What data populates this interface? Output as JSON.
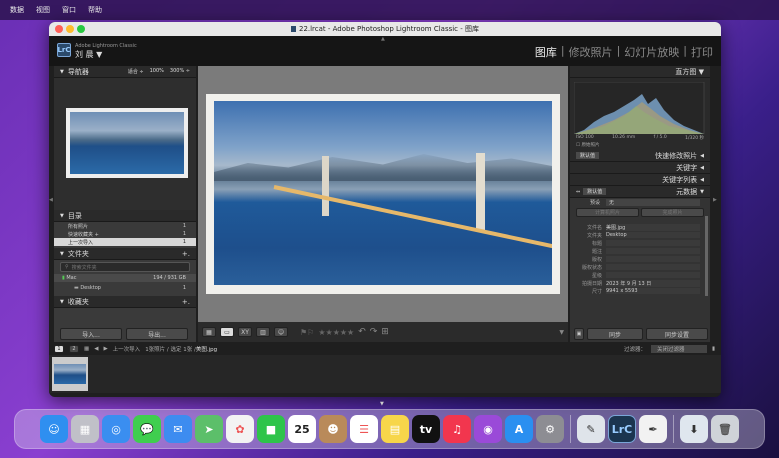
{
  "menubar": {
    "items": [
      "数据",
      "视图",
      "窗口",
      "帮助"
    ]
  },
  "window": {
    "title": "22.lrcat - Adobe Photoshop Lightroom Classic - 图库"
  },
  "identity": {
    "app_name": "Adobe Lightroom Classic",
    "user": "刘 晨 ▼",
    "logo": "LrC"
  },
  "modules": [
    {
      "label": "图库",
      "active": true
    },
    {
      "label": "修改照片",
      "active": false
    },
    {
      "label": "幻灯片放映",
      "active": false
    },
    {
      "label": "打印",
      "active": false
    }
  ],
  "navigator": {
    "title": "导航器",
    "zoom_options": [
      "适合 ÷",
      "100%",
      "300% ÷"
    ]
  },
  "catalog": {
    "title": "目录",
    "items": [
      {
        "label": "所有照片",
        "count": "1"
      },
      {
        "label": "快速收藏夹 +",
        "count": "1"
      },
      {
        "label": "上一次导入",
        "count": "1"
      }
    ]
  },
  "folders": {
    "title": "文件夹",
    "add": "+.",
    "search_placeholder": "搜索文件夹",
    "volume": {
      "name": "Mac",
      "info": "194 / 931 GB"
    },
    "folder": {
      "name": "Desktop",
      "count": "1"
    }
  },
  "collections": {
    "title": "收藏夹",
    "add": "+."
  },
  "left_buttons": {
    "import": "导入...",
    "export": "导出..."
  },
  "histogram": {
    "title": "直方图 ▼",
    "readouts": [
      "ISO 100",
      "10.26 mm",
      "f / 5.0",
      "1/320 秒"
    ],
    "original_label": "原始照片"
  },
  "quick_develop": {
    "preset": "默认值",
    "title": "快速修改照片"
  },
  "keywords": {
    "title": "关键字"
  },
  "keyword_list": {
    "title": "关键字列表"
  },
  "metadata": {
    "title": "元数据",
    "preset": "默认值",
    "preset_label": "预设",
    "preset_value": "无",
    "buttons": [
      "计算机照片",
      "完成照片"
    ],
    "fields": [
      {
        "label": "文件名",
        "value": "美图.jpg"
      },
      {
        "label": "文件夹",
        "value": "Desktop"
      },
      {
        "label": "标题",
        "value": ""
      },
      {
        "label": "题注",
        "value": ""
      },
      {
        "label": "版权",
        "value": ""
      },
      {
        "label": "版权状态",
        "value": ""
      },
      {
        "label": "星级",
        "value": ""
      },
      {
        "label": "拍摄日期",
        "value": "2023 年 9 月 13 日"
      },
      {
        "label": "尺寸",
        "value": "9941 x 5593"
      }
    ]
  },
  "right_buttons": {
    "sync": "同步",
    "sync_settings": "同步设置"
  },
  "filmstrip_bar": {
    "monitors": [
      "1",
      "2"
    ],
    "breadcrumb": "上一次导入",
    "selection_info": "1张照片 / 选定 1张 / ",
    "filename": "美图.jpg",
    "filter_label": "过滤器：",
    "filter_value": "关闭过滤器"
  },
  "toolbar": {
    "stars": "★★★★★"
  },
  "dock": {
    "apps": [
      {
        "name": "Finder",
        "color": "#2f8ff0",
        "glyph": "☺"
      },
      {
        "name": "Launchpad",
        "color": "#c0c0c8",
        "glyph": "▦"
      },
      {
        "name": "Safari",
        "color": "#3a8ef0",
        "glyph": "◎"
      },
      {
        "name": "Messages",
        "color": "#3fce4f",
        "glyph": "💬"
      },
      {
        "name": "Mail",
        "color": "#3d8cf0",
        "glyph": "✉"
      },
      {
        "name": "Maps",
        "color": "#5cbf6a",
        "glyph": "➤"
      },
      {
        "name": "Photos",
        "color": "#f3f3f3",
        "glyph": "✿"
      },
      {
        "name": "FaceTime",
        "color": "#2ec44a",
        "glyph": "■"
      },
      {
        "name": "Calendar",
        "color": "#ffffff",
        "glyph": "25"
      },
      {
        "name": "Contacts",
        "color": "#b98a5a",
        "glyph": "☻"
      },
      {
        "name": "Reminders",
        "color": "#ffffff",
        "glyph": "☰"
      },
      {
        "name": "Notes",
        "color": "#f7d64a",
        "glyph": "▤"
      },
      {
        "name": "TV",
        "color": "#111111",
        "glyph": "tv"
      },
      {
        "name": "Music",
        "color": "#f2364e",
        "glyph": "♫"
      },
      {
        "name": "Podcasts",
        "color": "#9a4ad8",
        "glyph": "◉"
      },
      {
        "name": "App Store",
        "color": "#2a8ff0",
        "glyph": "A"
      },
      {
        "name": "System Settings",
        "color": "#8d8d93",
        "glyph": "⚙"
      }
    ],
    "recent": [
      {
        "name": "Preview",
        "color": "#dfe4ea",
        "glyph": "✎"
      },
      {
        "name": "Lightroom Classic",
        "color": "#1b3550",
        "glyph": "LrC"
      },
      {
        "name": "TextEdit",
        "color": "#f2f2f2",
        "glyph": "✒"
      }
    ],
    "extras": [
      {
        "name": "Downloads",
        "color": "#dfe6ee",
        "glyph": "⬇"
      },
      {
        "name": "Trash",
        "color": "#cfd3d8",
        "glyph": "🗑"
      }
    ]
  }
}
